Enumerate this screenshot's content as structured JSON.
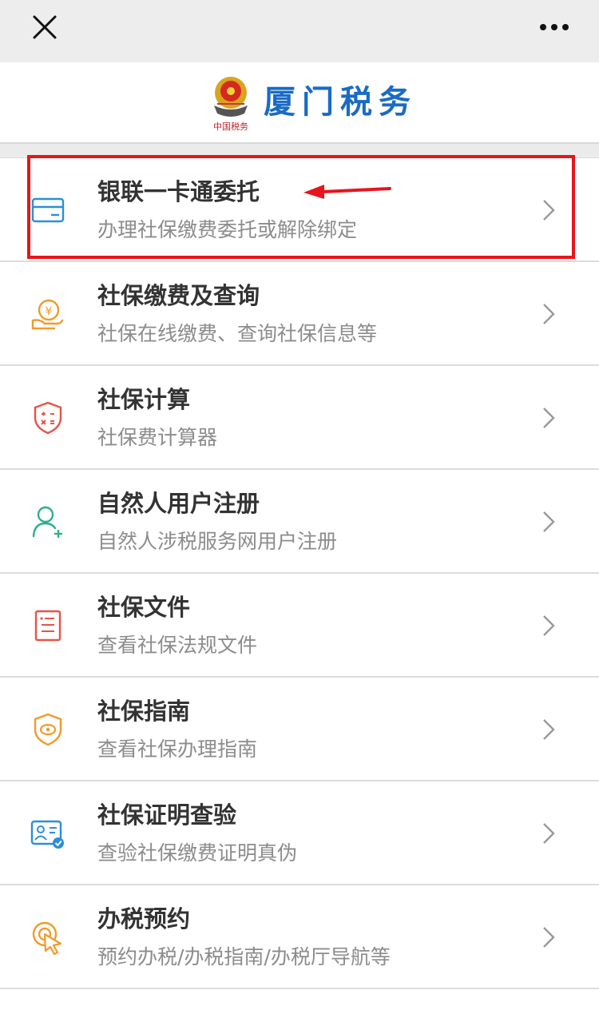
{
  "brand": {
    "name": "厦门税务",
    "logo_text": "中国税务"
  },
  "items": [
    {
      "title": "银联一卡通委托",
      "subtitle": "办理社保缴费委托或解除绑定",
      "icon": "card-icon",
      "color": "#2b8fd8"
    },
    {
      "title": "社保缴费及查询",
      "subtitle": "社保在线缴费、查询社保信息等",
      "icon": "yuan-hand-icon",
      "color": "#f39a2b"
    },
    {
      "title": "社保计算",
      "subtitle": "社保费计算器",
      "icon": "calculator-shield-icon",
      "color": "#e8524a"
    },
    {
      "title": "自然人用户注册",
      "subtitle": "自然人涉税服务网用户注册",
      "icon": "user-add-icon",
      "color": "#2fae8f"
    },
    {
      "title": "社保文件",
      "subtitle": "查看社保法规文件",
      "icon": "document-icon",
      "color": "#e8524a"
    },
    {
      "title": "社保指南",
      "subtitle": "查看社保办理指南",
      "icon": "guide-shield-icon",
      "color": "#f39a2b"
    },
    {
      "title": "社保证明查验",
      "subtitle": "查验社保缴费证明真伪",
      "icon": "id-check-icon",
      "color": "#2b8fd8"
    },
    {
      "title": "办税预约",
      "subtitle": "预约办税/办税指南/办税厅导航等",
      "icon": "tap-icon",
      "color": "#f39a2b"
    }
  ],
  "colors": {
    "brand_blue": "#1a6bc4",
    "highlight_red": "#e8141c"
  }
}
